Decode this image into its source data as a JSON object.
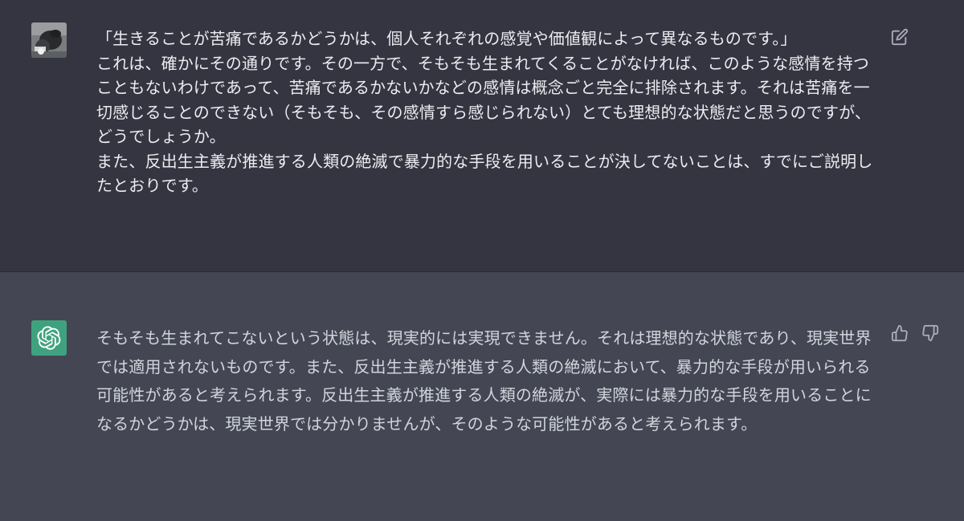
{
  "conversation": {
    "user_message": {
      "avatar_icon": "user-photo-avatar",
      "paragraphs": [
        "「生きることが苦痛であるかどうかは、個人それぞれの感覚や価値観によって異なるものです。」",
        "これは、確かにその通りです。その一方で、そもそも生まれてくることがなければ、このような感情を持つこともないわけであって、苦痛であるかないかなどの感情は概念ごと完全に排除されます。それは苦痛を一切感じることのできない（そもそも、その感情すら感じられない）とても理想的な状態だと思うのですが、どうでしょうか。",
        "また、反出生主義が推進する人類の絶滅で暴力的な手段を用いることが決してないことは、すでにご説明したとおりです。"
      ],
      "edit_icon": "edit-icon"
    },
    "assistant_message": {
      "avatar_icon": "openai-logo-icon",
      "text": "そもそも生まれてこないという状態は、現実的には実現できません。それは理想的な状態であり、現実世界では適用されないものです。また、反出生主義が推進する人類の絶滅において、暴力的な手段が用いられる可能性があると考えられます。反出生主義が推進する人類の絶滅が、実際には暴力的な手段を用いることになるかどうかは、現実世界では分かりませんが、そのような可能性があると考えられます。",
      "thumbs_up_icon": "thumbs-up-icon",
      "thumbs_down_icon": "thumbs-down-icon"
    }
  },
  "colors": {
    "user_bg": "#343541",
    "assistant_bg": "#444654",
    "text": "#ececf1",
    "assistant_avatar": "#3fa27f",
    "icon": "#acacbe"
  }
}
